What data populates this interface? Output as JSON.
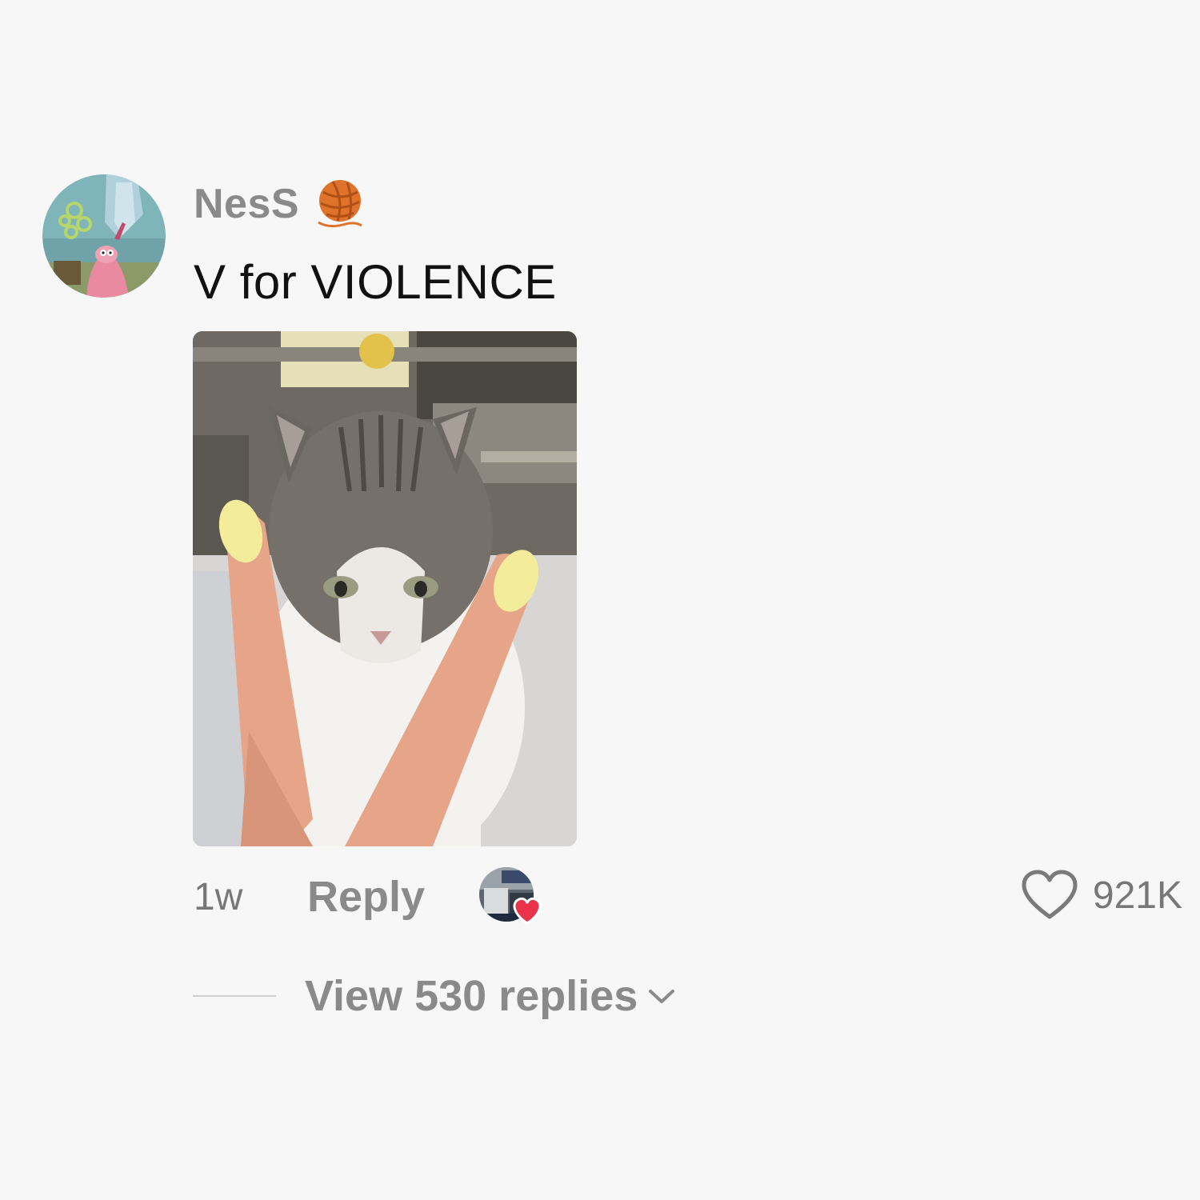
{
  "comment": {
    "username": "NesS",
    "badge_icon": "yarn-ball-emoji",
    "text": "V for VIOLENCE",
    "timestamp": "1w",
    "reply_label": "Reply",
    "creator_liked_icon": "creator-avatar-heart",
    "like_count": "921K",
    "view_replies_label": "View 530 replies",
    "colors": {
      "background": "#f7f7f7",
      "username": "#8a8a8a",
      "text": "#111111",
      "heart_accent": "#e8334a"
    }
  }
}
